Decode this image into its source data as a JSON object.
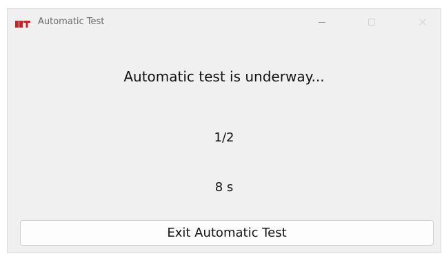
{
  "window": {
    "title": "Automatic Test",
    "logo_name": "app-logo-icon",
    "controls": [
      "minimize-icon",
      "maximize-icon",
      "close-icon"
    ]
  },
  "main": {
    "headline": "Automatic test is underway...",
    "progress": "1/2",
    "timer": "8 s"
  },
  "actions": {
    "exit_label": "Exit Automatic Test"
  },
  "colors": {
    "window_bg": "#f0f0f0",
    "logo_red": "#d21f1f",
    "text": "#111111",
    "title_text": "#6b6b6b"
  }
}
